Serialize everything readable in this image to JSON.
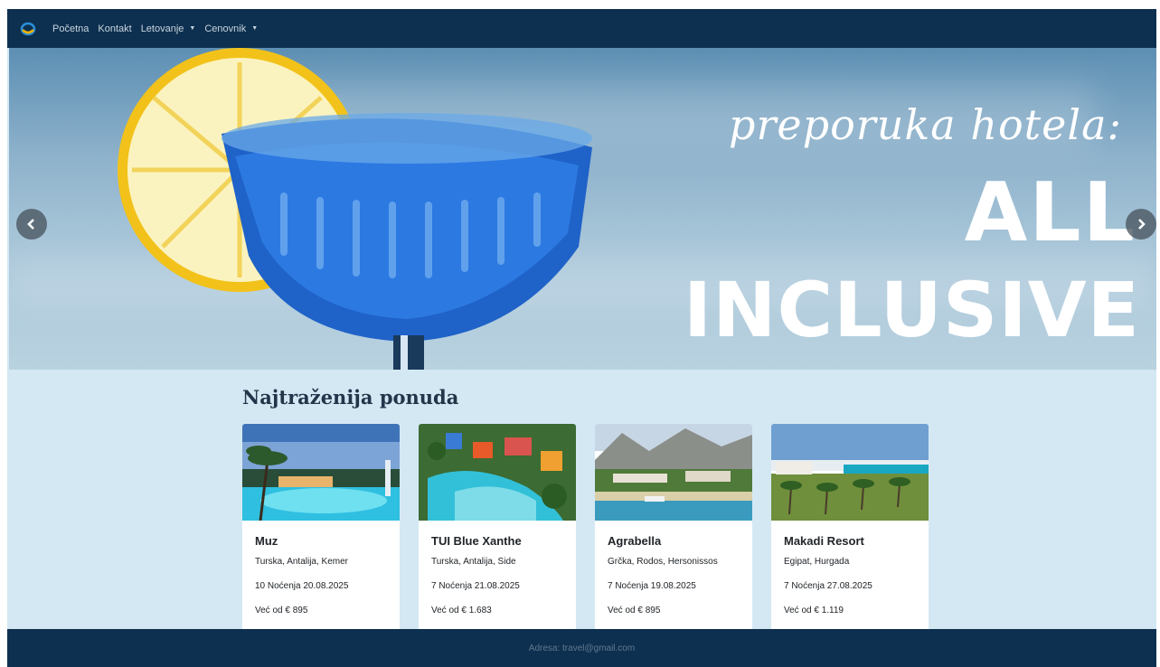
{
  "nav": {
    "items": [
      {
        "label": "Početna",
        "dropdown": false
      },
      {
        "label": "Kontakt",
        "dropdown": false
      },
      {
        "label": "Letovanje",
        "dropdown": true
      },
      {
        "label": "Cenovnik",
        "dropdown": true
      }
    ]
  },
  "hero": {
    "script_text": "preporuka hotela:",
    "line1": "ALL",
    "line2": "INCLUSIVE",
    "prev_icon": "chevron-left-icon",
    "next_icon": "chevron-right-icon"
  },
  "offers": {
    "title": "Najtraženija ponuda",
    "cards": [
      {
        "name": "Muz",
        "location": "Turska, Antalija, Kemer",
        "dates": "10 Noćenja 20.08.2025",
        "price": "Već od € 895"
      },
      {
        "name": "TUI Blue Xanthe",
        "location": "Turska, Antalija, Side",
        "dates": "7 Noćenja 21.08.2025",
        "price": "Već od € 1.683"
      },
      {
        "name": "Agrabella",
        "location": "Grčka, Rodos, Hersonissos",
        "dates": "7 Noćenja 19.08.2025",
        "price": "Već od € 895"
      },
      {
        "name": "Makadi Resort",
        "location": "Egipat, Hurgada",
        "dates": "7 Noćenja 27.08.2025",
        "price": "Već od € 1.119"
      }
    ]
  },
  "footer": {
    "text": "Adresa: travel@gmail.com"
  },
  "colors": {
    "navbar": "#0d3050",
    "page_bg": "#d4e8f4",
    "card_bg": "#ffffff"
  }
}
